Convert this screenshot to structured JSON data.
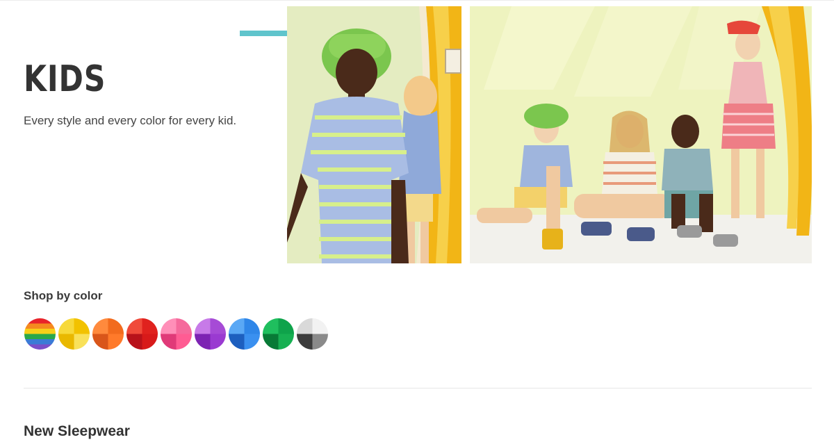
{
  "hero": {
    "title": "KIDS",
    "subtitle": "Every style and every color for every kid.",
    "accent_color": "#5fc4cc"
  },
  "shop_by_color": {
    "label": "Shop by color",
    "swatches": [
      {
        "name": "rainbow",
        "colors": [
          "#e8232a",
          "#f58a1f",
          "#f7d019",
          "#2aa84a",
          "#3b7bd6",
          "#7b4fc9"
        ]
      },
      {
        "name": "yellow",
        "colors": [
          "#f7d93a",
          "#f2c200",
          "#e9b800",
          "#f9e15a"
        ]
      },
      {
        "name": "orange",
        "colors": [
          "#ff8a3d",
          "#f26b1d",
          "#d9561a",
          "#ff7a2a"
        ]
      },
      {
        "name": "red",
        "colors": [
          "#f04a3a",
          "#e0221e",
          "#b8121a",
          "#d81a1a"
        ]
      },
      {
        "name": "pink",
        "colors": [
          "#ff8fb8",
          "#f56a9c",
          "#e03a78",
          "#ff5c93"
        ]
      },
      {
        "name": "purple",
        "colors": [
          "#c77ae8",
          "#a64bd6",
          "#7d23b3",
          "#9a3ad1"
        ]
      },
      {
        "name": "blue",
        "colors": [
          "#5aa8f5",
          "#2f86e8",
          "#1d5fbf",
          "#3a90f0"
        ]
      },
      {
        "name": "green",
        "colors": [
          "#1fbf5e",
          "#0fa34b",
          "#087a36",
          "#17b052"
        ]
      },
      {
        "name": "neutral",
        "colors": [
          "#d9d9d9",
          "#f2f2f2",
          "#3c3c3c",
          "#8a8a8a"
        ]
      }
    ]
  },
  "next_section": {
    "title": "New Sleepwear"
  }
}
